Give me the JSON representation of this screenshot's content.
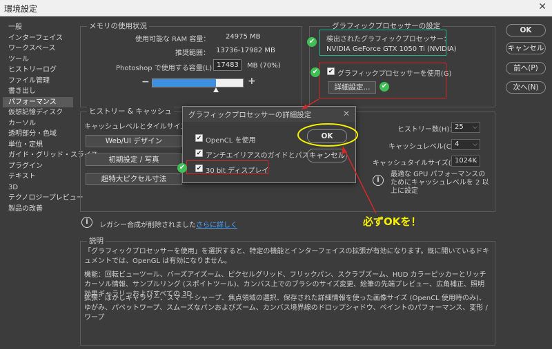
{
  "window": {
    "title": "環境設定",
    "close_glyph": "✕"
  },
  "sidebar": {
    "items": [
      {
        "label": "一般"
      },
      {
        "label": "インターフェイス"
      },
      {
        "label": "ワークスペース"
      },
      {
        "label": "ツール"
      },
      {
        "label": "ヒストリーログ"
      },
      {
        "label": "ファイル管理"
      },
      {
        "label": "書き出し"
      },
      {
        "label": "パフォーマンス",
        "active": true
      },
      {
        "label": "仮想記憶ディスク"
      },
      {
        "label": "カーソル"
      },
      {
        "label": "透明部分・色域"
      },
      {
        "label": "単位・定規"
      },
      {
        "label": "ガイド・グリッド・スライス"
      },
      {
        "label": "プラグイン"
      },
      {
        "label": "テキスト"
      },
      {
        "label": "3D"
      },
      {
        "label": "テクノロジープレビュー"
      },
      {
        "label": "製品の改善"
      }
    ]
  },
  "memory": {
    "title": "メモリの使用状況",
    "available_label": "使用可能な RAM 容量：",
    "available_value": "24975 MB",
    "range_label": "推奨範囲：",
    "range_value": "13736-17982 MB",
    "ps_label": "Photoshop で使用する容量(L)：",
    "ps_value": "17483",
    "ps_suffix": "MB (70%)",
    "minus": "−",
    "plus": "+",
    "slider_fraction": 0.7
  },
  "gpu": {
    "title": "グラフィックプロセッサーの設定",
    "detected_label": "検出されたグラフィックプロセッサー：",
    "detected_name": "NVIDIA GeForce GTX 1050 Ti (NVIDIA)",
    "use_gpu_label": "グラフィックプロセッサーを使用(G)",
    "advanced_button": "詳細設定..."
  },
  "history": {
    "title": "ヒストリー & キャッシュ",
    "cache_hint": "キャッシュレベルとタイルサイズの最",
    "buttons": [
      "Web/UI デザイン",
      "初期設定 / 写真",
      "超特大ピクセル寸法"
    ],
    "states_label": "ヒストリー数(H)：",
    "states_value": "25",
    "cache_levels_label": "キャッシュレベル(C)：",
    "cache_levels_value": "4",
    "tile_label": "キャッシュタイルサイズ(Z)：",
    "tile_value": "1024K",
    "info_text": "最適な GPU パフォーマンスのためにキャッシュレベルを 2 以上に設定"
  },
  "legacy": {
    "text": "レガシー合成が削除されました",
    "link": "さらに詳しく"
  },
  "description": {
    "title": "説明",
    "p1": "「グラフィックプロセッサーを使用」を選択すると、特定の機能とインターフェイスの拡張が有効になります。既に開いているドキュメントでは、OpenGL は有効になりません。",
    "p2": "機能：回転ビューツール、バーズアイズーム、ピクセルグリッド、フリックパン、スクラブズーム、HUD カラーピッカーとリッチカーソル情報、サンプルリング (スポイトツール)、カンバス上でのブラシのサイズ変更、絵筆の先端プレビュー、広角補正、照明効果ギャラリーおよびすべての 3D",
    "p3": "拡張：ぼかしギャラリー、スマートシャープ、焦点領域の選択、保存された詳細情報を使った画像サイズ (OpenCL 使用時のみ)、ゆがみ、パペットワープ、スムーズなパンおよびズーム、カンバス境界線のドロップシャドウ、ペイントのパフォーマンス、変形 / ワープ"
  },
  "right_buttons": {
    "ok": "OK",
    "cancel": "キャンセル",
    "prev": "前へ(P)",
    "next": "次へ(N)"
  },
  "dialog": {
    "title": "グラフィックプロセッサーの詳細設定",
    "close_glyph": "✕",
    "opt1": "OpenCL を使用",
    "opt2": "アンチエイリアスのガイドとパス",
    "opt3": "30 bit ディスプレイ",
    "ok": "OK",
    "cancel": "キャンセル"
  },
  "annotation": {
    "text": "必ずOKを！"
  },
  "colors": {
    "red": "#d22a2a",
    "green": "#3fbf55",
    "yellow": "#f5f000",
    "teal": "#25b58a",
    "slider_fill": "#3d8fe0"
  },
  "icons": {
    "check": "✔",
    "chevron": "⌵",
    "info": "i"
  }
}
